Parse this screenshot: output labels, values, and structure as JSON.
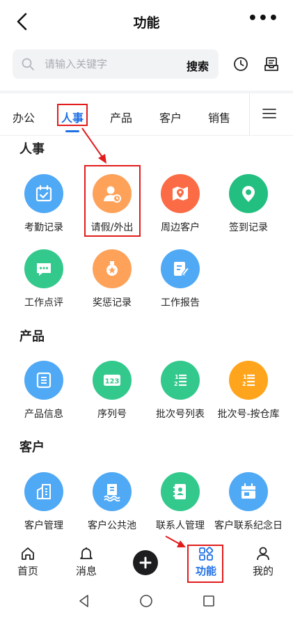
{
  "header": {
    "title": "功能",
    "more": "•••"
  },
  "search": {
    "placeholder": "请输入关键字",
    "button_label": "搜索"
  },
  "tabs": [
    {
      "label": "办公"
    },
    {
      "label": "人事"
    },
    {
      "label": "产品"
    },
    {
      "label": "客户"
    },
    {
      "label": "销售"
    }
  ],
  "active_tab": "人事",
  "sections": [
    {
      "title": "人事",
      "items": [
        {
          "label": "考勤记录",
          "icon": "calendar-check-icon",
          "color": "#4fa9f5"
        },
        {
          "label": "请假/外出",
          "icon": "person-clock-icon",
          "color": "#fea25a"
        },
        {
          "label": "周边客户",
          "icon": "map-pin-icon",
          "color": "#fb6b45"
        },
        {
          "label": "签到记录",
          "icon": "location-pin-icon",
          "color": "#22bf80"
        },
        {
          "label": "工作点评",
          "icon": "chat-bubble-icon",
          "color": "#33c88c"
        },
        {
          "label": "奖惩记录",
          "icon": "medal-icon",
          "color": "#fea25a"
        },
        {
          "label": "工作报告",
          "icon": "document-edit-icon",
          "color": "#4fa9f5"
        }
      ]
    },
    {
      "title": "产品",
      "items": [
        {
          "label": "产品信息",
          "icon": "list-doc-icon",
          "color": "#4fa9f5"
        },
        {
          "label": "序列号",
          "icon": "number-123-icon",
          "color": "#33c88c"
        },
        {
          "label": "批次号列表",
          "icon": "numbered-list-icon",
          "color": "#33c88c"
        },
        {
          "label": "批次号-按仓库",
          "icon": "numbered-list-icon",
          "color": "#ffa51d"
        }
      ]
    },
    {
      "title": "客户",
      "items": [
        {
          "label": "客户管理",
          "icon": "building-icon",
          "color": "#4fa9f5"
        },
        {
          "label": "客户公共池",
          "icon": "pool-building-icon",
          "color": "#4fa9f5"
        },
        {
          "label": "联系人管理",
          "icon": "contact-book-icon",
          "color": "#33c88c"
        },
        {
          "label": "客户联系纪念日",
          "icon": "calendar-icon",
          "color": "#4fa9f5"
        }
      ]
    }
  ],
  "bottom_nav": [
    {
      "label": "首页",
      "icon": "home-icon"
    },
    {
      "label": "消息",
      "icon": "bell-icon"
    },
    {
      "label": "",
      "icon": "plus-icon"
    },
    {
      "label": "功能",
      "icon": "grid-apps-icon"
    },
    {
      "label": "我的",
      "icon": "person-icon"
    }
  ],
  "active_nav": "功能",
  "colors": {
    "accent": "#1f6fe5",
    "annotation": "#e21b1b"
  }
}
